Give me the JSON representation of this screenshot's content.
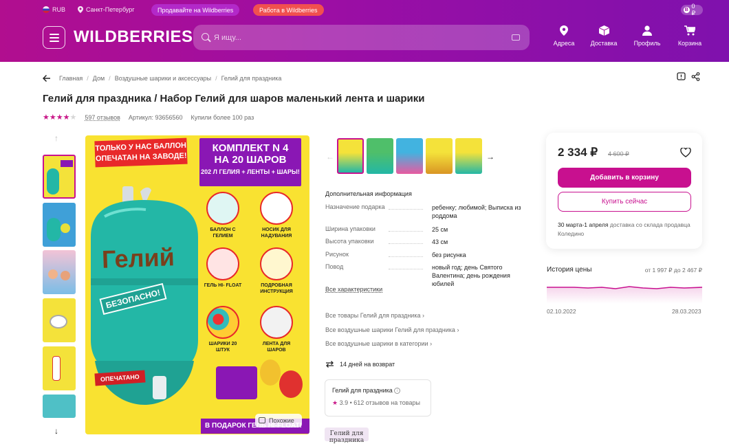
{
  "topbar": {
    "currency": "RUB",
    "city": "Санкт-Петербург",
    "sell_label": "Продавайте на Wildberries",
    "sell_color": "#b329c9",
    "work_label": "Работа в Wildberries",
    "work_color": "#f1504f",
    "wallet_value": "0 ₽"
  },
  "header": {
    "logo": "WILDBERRIES",
    "search_placeholder": "Я ищу...",
    "nav": [
      {
        "label": "Адреса",
        "icon": "map-pin-icon"
      },
      {
        "label": "Доставка",
        "icon": "box-icon"
      },
      {
        "label": "Профиль",
        "icon": "person-icon"
      },
      {
        "label": "Корзина",
        "icon": "cart-icon"
      }
    ]
  },
  "breadcrumbs": [
    "Главная",
    "Дом",
    "Воздушные шарики и аксессуары",
    "Гелий для праздника"
  ],
  "product": {
    "title": "Гелий для праздника / Набор Гелий для шаров маленький лента и шарики",
    "stars": 4,
    "reviews": "597 отзывов",
    "article_label": "Артикул:",
    "article": "93656560",
    "bought": "Купили более 100 раз"
  },
  "main_image": {
    "banner": "ТОЛЬКО У НАС БАЛЛОН ОПЕЧАТАН НА ЗАВОДЕ!",
    "kit_line1": "КОМПЛЕКТ N 4",
    "kit_line2": "НА 20 ШАРОВ",
    "kit_line3": "202 Л ГЕЛИЯ + ЛЕНТЫ + ШАРЫ!",
    "tank_text": "Гелий",
    "safe": "БЕЗОПАСНО!",
    "sealed": "ОПЕЧАТАНО",
    "features": [
      "БАЛЛОН С ГЕЛИЕМ",
      "НОСИК ДЛЯ НАДУВАНИЯ",
      "ГЕЛЬ HI- FLOAT",
      "ПОДРОБНАЯ ИНСТРУКЦИЯ",
      "ШАРИКИ 20 ШТУК",
      "ЛЕНТА ДЛЯ ШАРОВ"
    ],
    "gift": "В ПОДАРОК ГЕЛЬ HI-FLOAT!",
    "similar_label": "Похожие"
  },
  "info": {
    "title": "Дополнительная информация",
    "specs": [
      {
        "k": "Назначение подарка",
        "v": "ребенку; любимой; Выписка из роддома"
      },
      {
        "k": "Ширина упаковки",
        "v": "25 см"
      },
      {
        "k": "Высота упаковки",
        "v": "43 см"
      },
      {
        "k": "Рисунок",
        "v": "без рисунка"
      },
      {
        "k": "Повод",
        "v": "новый год; день Святого Валентина; день рождения юбилей"
      }
    ],
    "all_specs": "Все характеристики",
    "links": [
      "Все товары Гелий для праздника",
      "Все воздушные шарики Гелий для праздника",
      "Все воздушные шарики в категории"
    ],
    "return": "14 дней на возврат",
    "seller_name": "Гелий для праздника",
    "seller_rating": "3.9",
    "seller_reviews": "• 612 отзывов на товары",
    "brand_logo": "Гелий для праздника"
  },
  "buy": {
    "price": "2 334 ₽",
    "old_price": "4 600 ₽",
    "add_to_cart": "Добавить в корзину",
    "buy_now": "Купить сейчас",
    "delivery_dates": "30 марта-1 апреля",
    "delivery_text": "доставка со склада продавца Коледино"
  },
  "price_history": {
    "title": "История цены",
    "range": "от 1 997 ₽ до 2 467 ₽",
    "date_from": "02.10.2022",
    "date_to": "28.03.2023"
  }
}
